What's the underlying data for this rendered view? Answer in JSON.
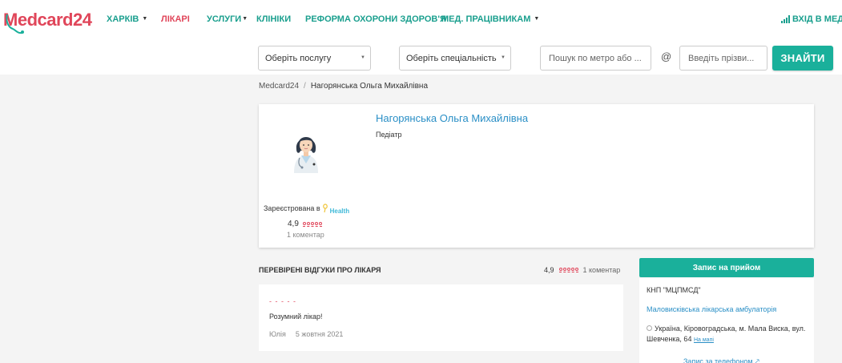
{
  "header": {
    "logo_text": "Medcard24",
    "logo_m": "M",
    "logo_rest": "edcard24",
    "nav": [
      {
        "label": "ХАРКІВ",
        "has_caret": true
      },
      {
        "label": "ЛІКАРІ",
        "active": true
      },
      {
        "label": "УСЛУГИ",
        "has_caret": true
      },
      {
        "label": "КЛІНІКИ"
      },
      {
        "label": "РЕФОРМА ОХОРОНИ ЗДОРОВ'Я"
      },
      {
        "label": "МЕД. ПРАЦІВНИКАМ",
        "has_caret": true
      }
    ],
    "caret": "▼",
    "login": "ВХІД В МЕДІ"
  },
  "search": {
    "service_select": "Оберіть послугу",
    "specialty_select": "Оберіть спеціальність",
    "metro_placeholder": "Пошук по метро або ...",
    "at": "@",
    "name_placeholder": "Введіть прізви...",
    "find_button": "ЗНАЙТИ",
    "select_arrow": "▼"
  },
  "breadcrumb": {
    "root": "Medcard24",
    "separator": "/",
    "current": "Нагорянська Ольга Михайлівна"
  },
  "doctor": {
    "name": "Нагорянська Ольга Михайлівна",
    "specialty": "Педіатр",
    "registered_label": "Зареєстрована в",
    "registered_service": "Health",
    "rating": "4,9",
    "comments": "1 коментар"
  },
  "reviews": {
    "title": "ПЕРЕВІРЕНІ ВІДГУКИ ПРО ЛІКАРЯ",
    "rating": "4,9",
    "count": "1 коментар",
    "items": [
      {
        "stars": "- - - - -",
        "text": "Розумний лікар!",
        "author": "Юлія",
        "date": "5 жовтня 2021"
      }
    ]
  },
  "booking": {
    "button": "Запис на прийом",
    "clinic_name": "КНП \"МЦПМСД\"",
    "clinic_link": "Маловисківська лікарська амбулаторія",
    "address": "Україна, Кіровоградська, м. Мала Виска, вул. Шевченка, 64",
    "map_link": "На мапі",
    "phone_link": "Запис за телефоном 🡕"
  },
  "colors": {
    "brand_red": "#e0465a",
    "brand_teal": "#1ab09b",
    "link_blue": "#2a8fc6"
  }
}
